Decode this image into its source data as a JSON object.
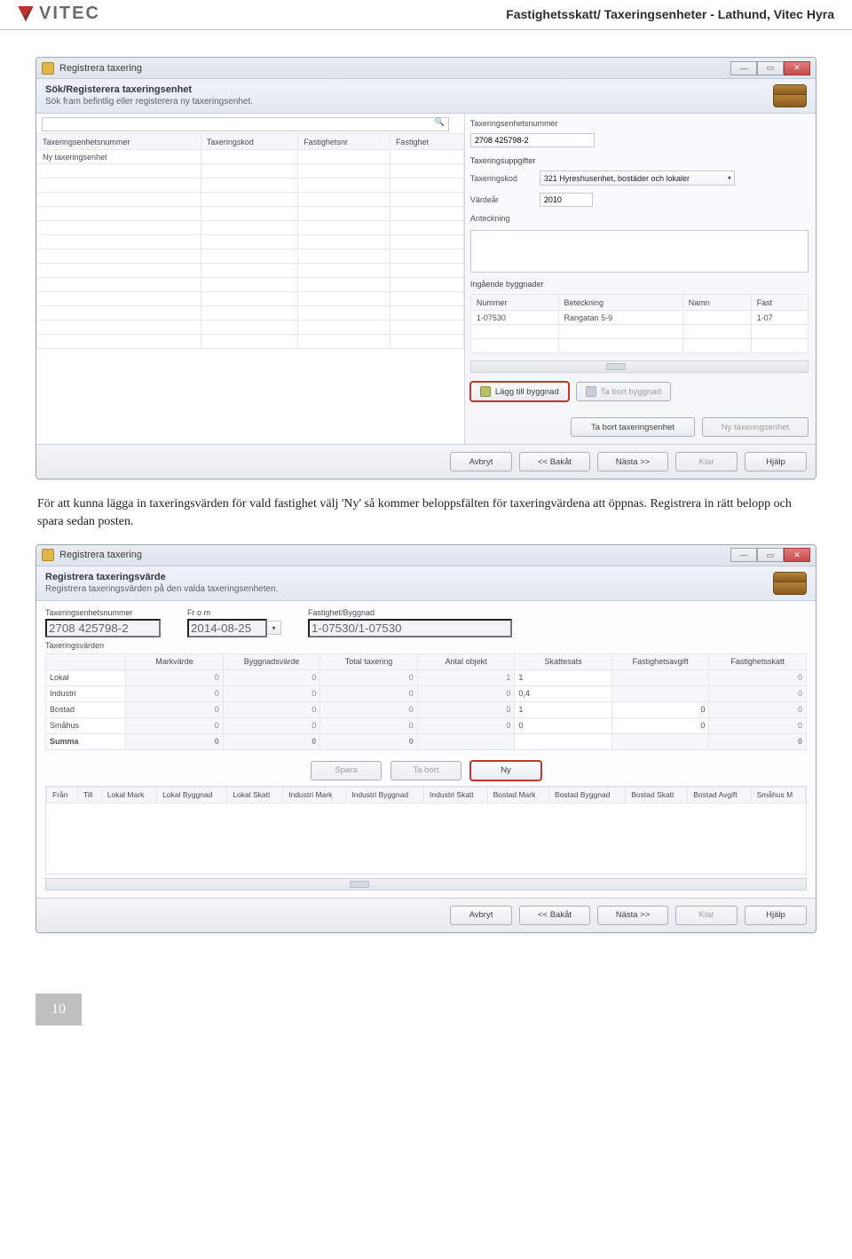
{
  "page": {
    "header_title": "Fastighetsskatt/ Taxeringsenheter - Lathund, Vitec Hyra",
    "logo_text": "VITEC",
    "page_number": "10"
  },
  "body_text": "För att kunna lägga in taxeringsvärden för vald fastighet välj 'Ny' så kommer beloppsfälten för taxeringvärdena att öppnas. Registrera in rätt belopp och spara sedan posten.",
  "win1": {
    "title": "Registrera taxering",
    "subheader_title": "Sök/Registerera taxeringsenhet",
    "subheader_sub": "Sök fram befintlig eller registerera ny taxeringsenhet.",
    "search_placeholder": "",
    "grid_cols": [
      "Taxeringsenhetsnummer",
      "Taxeringskod",
      "Fastighetsnr",
      "Fastighet"
    ],
    "grid_rows": [
      [
        "Ny taxeringsenhet",
        "",
        "",
        ""
      ]
    ],
    "right": {
      "enhetsnummer_label": "Taxeringsenhetsnummer",
      "enhetsnummer_value": "2708 425798-2",
      "uppgifter_label": "Taxeringsuppgifter",
      "taxkod_label": "Taxeringskod",
      "taxkod_value": "321 Hyreshusenhet, bostäder och lokaler",
      "vardear_label": "Värdeår",
      "vardear_value": "2010",
      "anteck_label": "Anteckning",
      "ing_label": "Ingående byggnader",
      "ing_cols": [
        "Nummer",
        "Beteckning",
        "Namn",
        "Fast"
      ],
      "ing_rows": [
        [
          "1-07530",
          "Rangatan 5-9",
          "",
          "1-07"
        ]
      ],
      "btn_add": "Lägg till byggnad",
      "btn_del": "Ta bort byggnad",
      "btn_del_enhet": "Ta bort taxeringsenhet",
      "btn_new_enhet": "Ny taxeringsenhet"
    },
    "footer": {
      "avbryt": "Avbryt",
      "bakat": "<< Bakåt",
      "nasta": "Nästa >>",
      "klar": "Klar",
      "hjalp": "Hjälp"
    }
  },
  "win2": {
    "title": "Registrera taxering",
    "subheader_title": "Registrera taxeringsvärde",
    "subheader_sub": "Registrera taxeringsvärden på den valda taxeringsenheten.",
    "fields": {
      "enhetsnr_label": "Taxeringsenhetsnummer",
      "enhetsnr_value": "2708 425798-2",
      "from_label": "Fr o m",
      "from_value": "2014-08-25",
      "fastbygg_label": "Fastighet/Byggnad",
      "fastbygg_value": "1-07530/1-07530"
    },
    "tax_section_label": "Taxeringsvärden",
    "tax_cols": [
      "",
      "Markvärde",
      "Byggnadsvärde",
      "Total taxering",
      "Antal objekt",
      "Skattesats",
      "Fastighetsavgift",
      "Fastighetsskatt"
    ],
    "tax_rows": [
      {
        "label": "Lokal",
        "mark": "0",
        "bygg": "0",
        "total": "0",
        "antal": "1",
        "sats": "1",
        "avgift": "",
        "skatt": "0"
      },
      {
        "label": "Industri",
        "mark": "0",
        "bygg": "0",
        "total": "0",
        "antal": "0",
        "sats": "0,4",
        "avgift": "",
        "skatt": "0"
      },
      {
        "label": "Bostad",
        "mark": "0",
        "bygg": "0",
        "total": "0",
        "antal": "0",
        "sats": "1",
        "avgift": "0",
        "skatt": "0"
      },
      {
        "label": "Småhus",
        "mark": "0",
        "bygg": "0",
        "total": "0",
        "antal": "0",
        "sats": "0",
        "avgift": "0",
        "skatt": "0"
      },
      {
        "label": "Summa",
        "mark": "0",
        "bygg": "0",
        "total": "0",
        "antal": "",
        "sats": "",
        "avgift": "",
        "skatt": "0"
      }
    ],
    "btns": {
      "spara": "Spara",
      "tabort": "Ta bort",
      "ny": "Ny"
    },
    "history_cols": [
      "Från",
      "Till",
      "Lokal Mark",
      "Lokal Byggnad",
      "Lokal Skatt",
      "Industri Mark",
      "Industri Byggnad",
      "Industri Skatt",
      "Bostad Mark",
      "Bostad Byggnad",
      "Bostad Skatt",
      "Bostad Avgift",
      "Småhus M"
    ],
    "footer": {
      "avbryt": "Avbryt",
      "bakat": "<< Bakåt",
      "nasta": "Nästa >>",
      "klar": "Klar",
      "hjalp": "Hjälp"
    }
  }
}
